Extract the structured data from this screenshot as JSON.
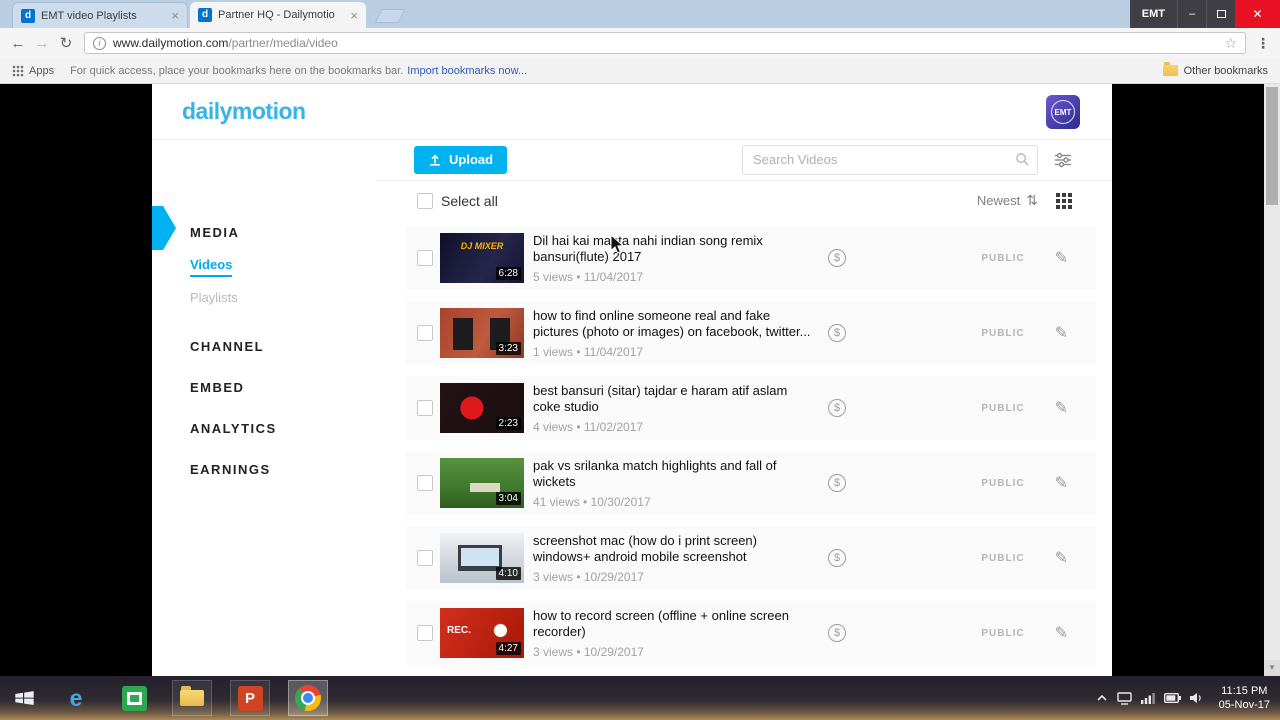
{
  "browser": {
    "tabs": [
      {
        "title": "EMT video Playlists"
      },
      {
        "title": "Partner HQ - Dailymotio"
      }
    ],
    "window_badge": "EMT",
    "url": {
      "domain": "www.dailymotion.com",
      "path": "/partner/media/video"
    },
    "bookmarks_bar": {
      "apps_label": "Apps",
      "hint": "For quick access, place your bookmarks here on the bookmarks bar.",
      "import_link": "Import bookmarks now...",
      "other_bookmarks": "Other bookmarks"
    }
  },
  "icons": {
    "back": "←",
    "forward": "→",
    "reload": "↻",
    "menu": "⋮",
    "star": "☆",
    "info": "i",
    "tab_close": "×",
    "window_min": "–",
    "window_close": "✕",
    "favicon_letter": "d",
    "sort": "⇅",
    "edit": "✎",
    "money": "$",
    "scroll_down": "▼",
    "ie_letter": "e",
    "powerpoint_letter": "P"
  },
  "page": {
    "brand": "dailymotion",
    "avatar_label": "EMT",
    "sidebar": {
      "media": "MEDIA",
      "videos": "Videos",
      "playlists": "Playlists",
      "channel": "CHANNEL",
      "embed": "EMBED",
      "analytics": "ANALYTICS",
      "earnings": "EARNINGS"
    },
    "toolbar": {
      "upload_label": "Upload",
      "search_placeholder": "Search Videos"
    },
    "list_header": {
      "select_all": "Select all",
      "sort_label": "Newest"
    },
    "videos": [
      {
        "title": "Dil hai kai manta nahi indian song remix bansuri(flute) 2017",
        "meta": "5 views • 11/04/2017",
        "duration": "6:28",
        "status": "PUBLIC",
        "thumb_label": "DJ MIXER"
      },
      {
        "title": "how to find online someone real and fake pictures (photo or images) on facebook, twitter...",
        "meta": "1 views • 11/04/2017",
        "duration": "3:23",
        "status": "PUBLIC",
        "thumb_label": ""
      },
      {
        "title": "best bansuri (sitar) tajdar e haram atif aslam coke studio",
        "meta": "4 views • 11/02/2017",
        "duration": "2:23",
        "status": "PUBLIC",
        "thumb_label": ""
      },
      {
        "title": "pak vs srilanka match highlights and fall of wickets",
        "meta": "41 views • 10/30/2017",
        "duration": "3:04",
        "status": "PUBLIC",
        "thumb_label": ""
      },
      {
        "title": "screenshot mac (how do i print screen) windows+ android mobile screenshot",
        "meta": "3 views • 10/29/2017",
        "duration": "4:10",
        "status": "PUBLIC",
        "thumb_label": ""
      },
      {
        "title": "how to record screen (offline + online screen recorder)",
        "meta": "3 views • 10/29/2017",
        "duration": "4:27",
        "status": "PUBLIC",
        "thumb_label": "REC."
      }
    ]
  },
  "taskbar": {
    "time": "11:15 PM",
    "date": "05-Nov-17"
  },
  "colors": {
    "accent": "#00b2f0",
    "brand": "#38b3e8",
    "close_red": "#e81123"
  }
}
